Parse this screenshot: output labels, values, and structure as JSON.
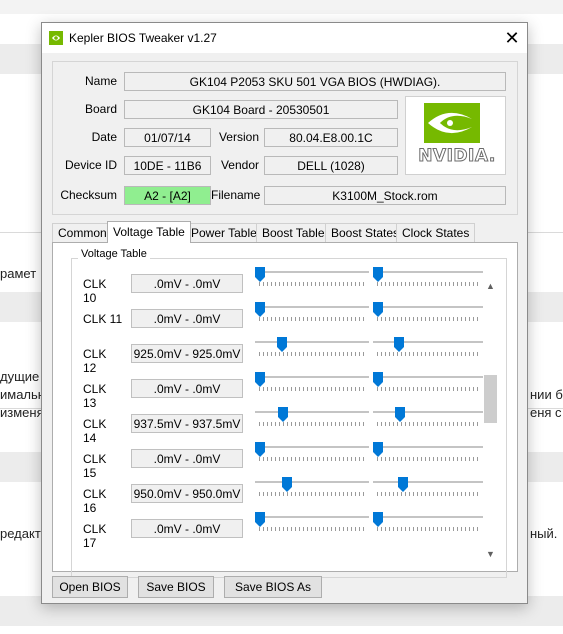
{
  "window": {
    "title": "Kepler BIOS Tweaker v1.27"
  },
  "background": {
    "texts": [
      "рамет",
      "дущие",
      "имальн",
      "изменя",
      "нии б",
      "еня с",
      "редакт",
      "ный."
    ]
  },
  "info": {
    "name_label": "Name",
    "name_value": "GK104 P2053 SKU 501 VGA BIOS (HWDIAG).",
    "board_label": "Board",
    "board_value": "GK104 Board - 20530501",
    "date_label": "Date",
    "date_value": "01/07/14",
    "version_label": "Version",
    "version_value": "80.04.E8.00.1C",
    "device_label": "Device ID",
    "device_value": "10DE - 11B6",
    "vendor_label": "Vendor",
    "vendor_value": "DELL (1028)",
    "checksum_label": "Checksum",
    "checksum_value": "A2 - [A2]",
    "filename_label": "Filename",
    "filename_value": "K3100M_Stock.rom",
    "logo_text": "NVIDIA."
  },
  "tabs": [
    {
      "label": "Common"
    },
    {
      "label": "Voltage Table"
    },
    {
      "label": "Power Table"
    },
    {
      "label": "Boost Table"
    },
    {
      "label": "Boost States"
    },
    {
      "label": "Clock States"
    }
  ],
  "voltage_group_title": "Voltage Table",
  "clocks": [
    {
      "label": "CLK 10",
      "value": ".0mV - .0mV",
      "slider1": 0.0,
      "slider2": 0.0
    },
    {
      "label": "CLK 11",
      "value": ".0mV - .0mV",
      "slider1": 0.0,
      "slider2": 0.0
    },
    {
      "label": "CLK 12",
      "value": "925.0mV - 925.0mV",
      "slider1": 0.21,
      "slider2": 0.21
    },
    {
      "label": "CLK 13",
      "value": ".0mV - .0mV",
      "slider1": 0.0,
      "slider2": 0.0
    },
    {
      "label": "CLK 14",
      "value": "937.5mV - 937.5mV",
      "slider1": 0.22,
      "slider2": 0.22
    },
    {
      "label": "CLK 15",
      "value": ".0mV - .0mV",
      "slider1": 0.0,
      "slider2": 0.0
    },
    {
      "label": "CLK 16",
      "value": "950.0mV - 950.0mV",
      "slider1": 0.26,
      "slider2": 0.25
    },
    {
      "label": "CLK 17",
      "value": ".0mV - .0mV",
      "slider1": 0.0,
      "slider2": 0.0
    }
  ],
  "buttons": {
    "open": "Open BIOS",
    "save": "Save BIOS",
    "save_as": "Save BIOS As"
  },
  "colors": {
    "checksum_ok": "#90ee90",
    "slider_thumb": "#0078d7",
    "nvidia_green": "#76b900"
  }
}
